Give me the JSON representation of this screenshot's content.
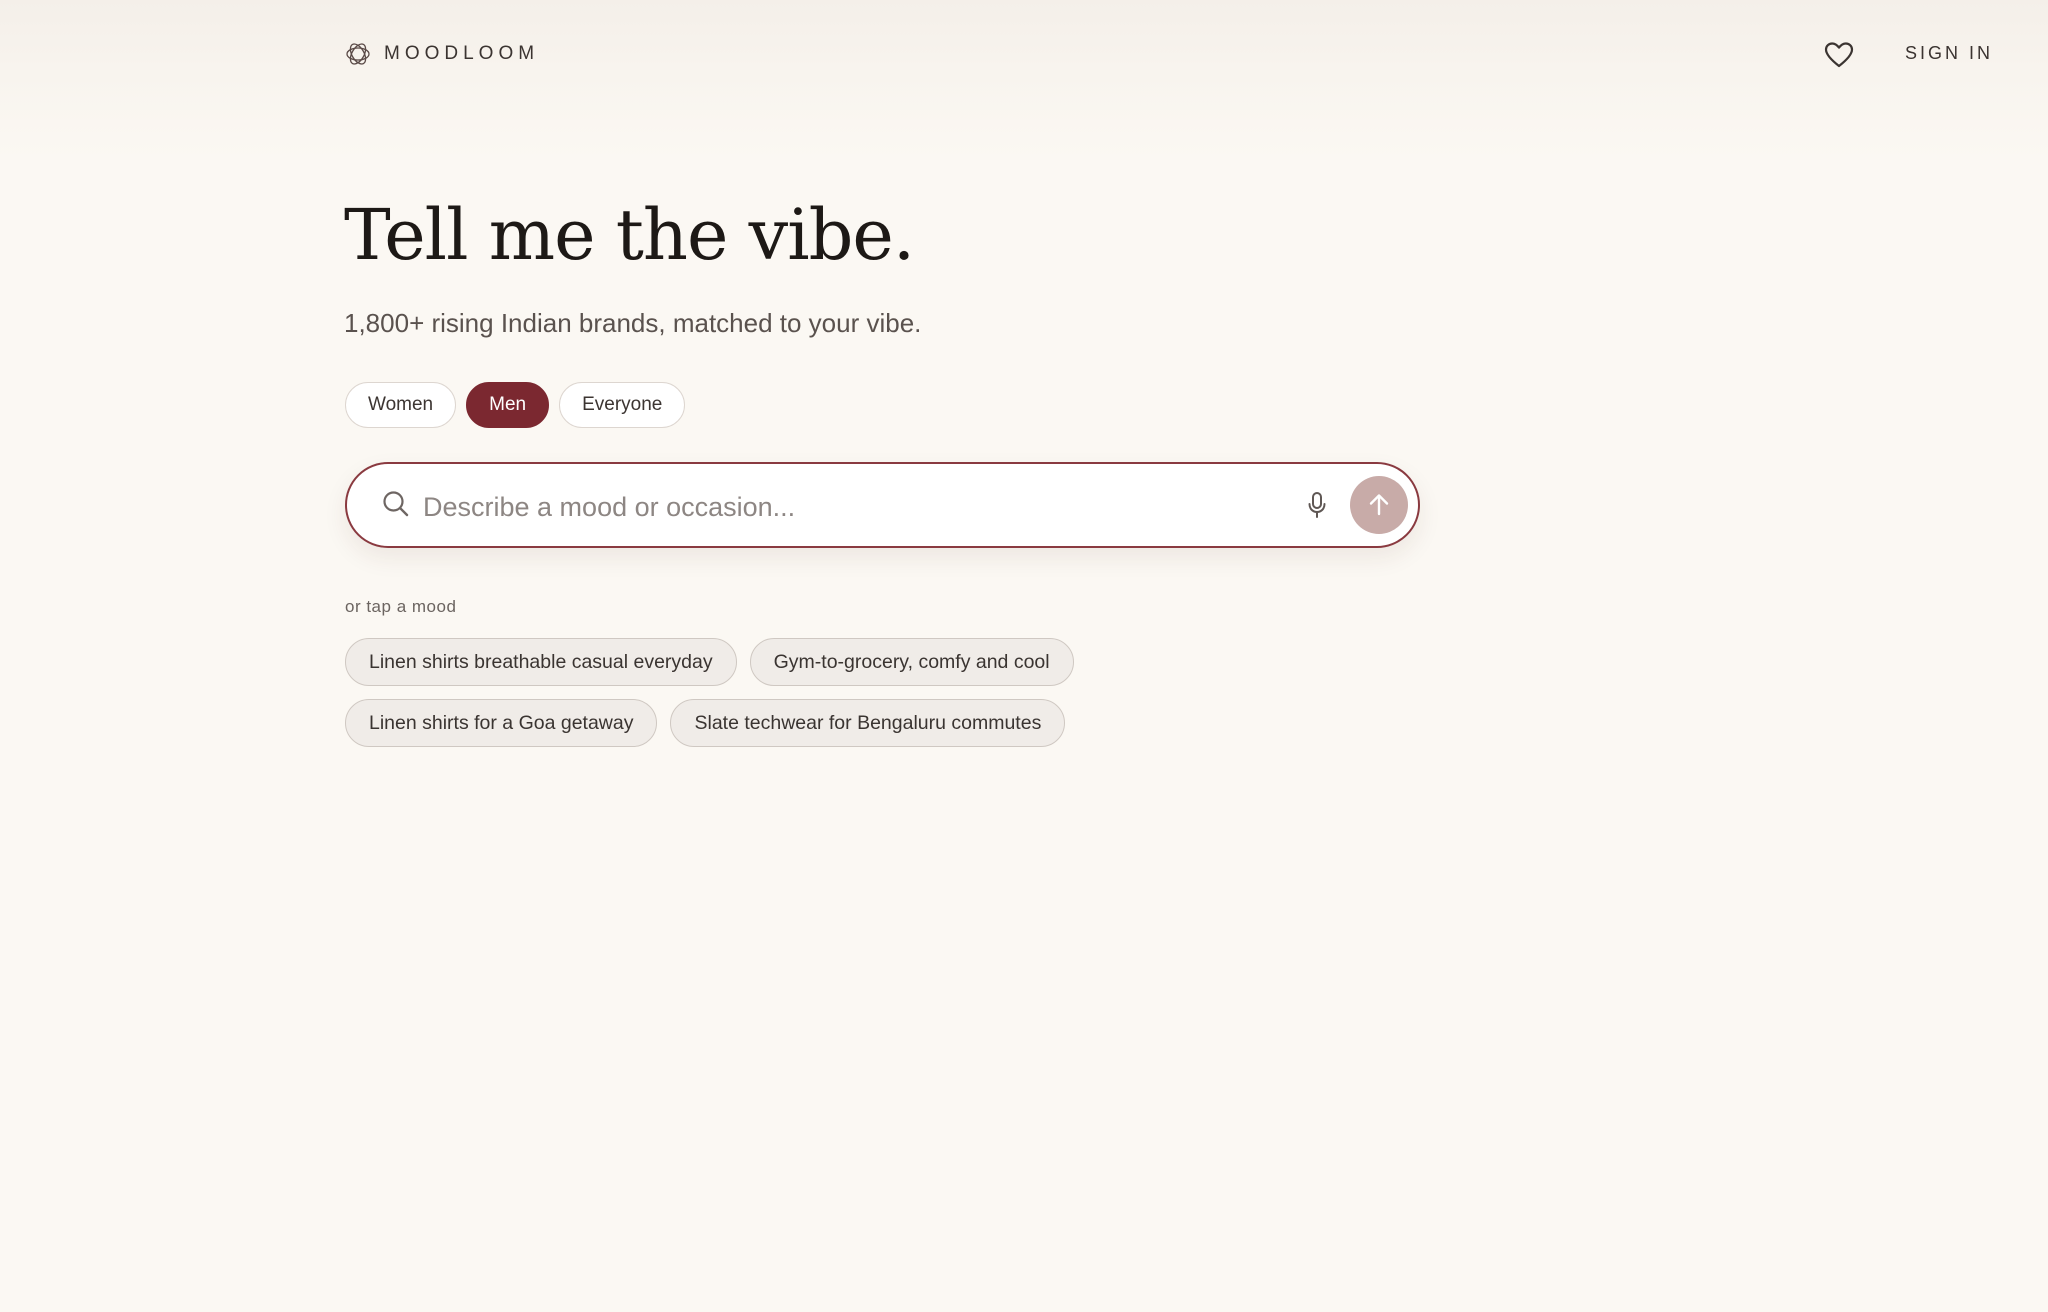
{
  "header": {
    "brand_name": "MOODLOOM",
    "signin_label": "SIGN IN",
    "icons": {
      "logo": "moodloom-logo-icon",
      "favorites": "heart-icon"
    }
  },
  "hero": {
    "title": "Tell me the vibe.",
    "subtitle": "1,800+ rising Indian brands, matched to your vibe."
  },
  "gender": {
    "options": [
      "Women",
      "Men",
      "Everyone"
    ],
    "selected": "Men"
  },
  "search": {
    "placeholder": "Describe a mood or occasion...",
    "value": "",
    "icons": {
      "search": "search-icon",
      "voice": "microphone-icon",
      "submit": "arrow-up-icon"
    }
  },
  "moods": {
    "hint": "or tap a mood",
    "suggestions": [
      "Linen shirts breathable casual everyday",
      "Gym-to-grocery, comfy and cool",
      "Linen shirts for a Goa getaway",
      "Slate techwear for Bengaluru commutes"
    ]
  },
  "colors": {
    "background": "#fbf8f3",
    "accent": "#7b2830",
    "search_border": "#8a3a40",
    "submit_button": "#c8aba8"
  }
}
